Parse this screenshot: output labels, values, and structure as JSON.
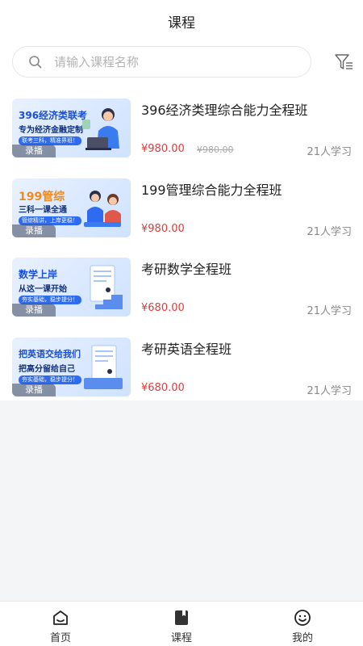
{
  "header": {
    "title": "课程"
  },
  "search": {
    "placeholder": "请输入课程名称",
    "icon": "search-icon"
  },
  "filter": {
    "icon": "filter-icon"
  },
  "courses": [
    {
      "title": "396经济类理综合能力全程班",
      "price": "¥980.00",
      "original_price": "¥980.00",
      "learners": "21人学习",
      "tag": "录播",
      "thumb_line1": "396经济类联考",
      "thumb_line2": "专为经济金融定制",
      "thumb_pill": "联考三科，精准界班！"
    },
    {
      "title": "199管理综合能力全程班",
      "price": "¥980.00",
      "original_price": "",
      "learners": "21人学习",
      "tag": "录播",
      "thumb_line1": "199管综",
      "thumb_line2": "三科一课全通",
      "thumb_pill": "管综精讲，上岸更稳！"
    },
    {
      "title": "考研数学全程班",
      "price": "¥680.00",
      "original_price": "",
      "learners": "21人学习",
      "tag": "录播",
      "thumb_line1": "数学上岸",
      "thumb_line2": "从这一课开始",
      "thumb_pill": "夯实基础，稳步提分！"
    },
    {
      "title": "考研英语全程班",
      "price": "¥680.00",
      "original_price": "",
      "learners": "21人学习",
      "tag": "录播",
      "thumb_line1": "把英语交给我们",
      "thumb_line2": "把高分留给自己",
      "thumb_pill": "夯实基础，稳步提分！"
    }
  ],
  "tabbar": {
    "items": [
      {
        "label": "首页",
        "icon": "home-icon"
      },
      {
        "label": "课程",
        "icon": "course-book-icon"
      },
      {
        "label": "我的",
        "icon": "smile-profile-icon"
      }
    ]
  },
  "colors": {
    "price": "#e03c3c",
    "thumb_accent": "#2e6bf0"
  }
}
